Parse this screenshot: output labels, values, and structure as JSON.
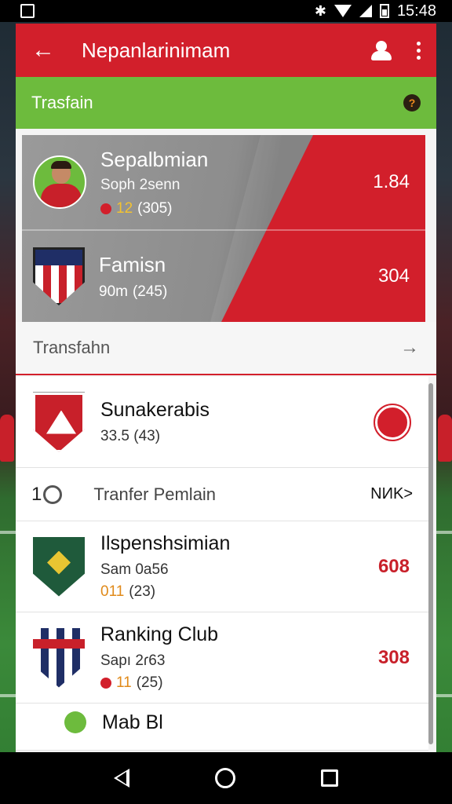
{
  "status_bar": {
    "time": "15:48",
    "icons": [
      "gallery-icon",
      "bluetooth-icon",
      "wifi-icon",
      "signal-icon",
      "battery-icon"
    ]
  },
  "header": {
    "title": "Nepanlarinimam",
    "back_icon": "arrow-left-icon",
    "action_icons": [
      "profile-icon",
      "more-vert-icon"
    ]
  },
  "subheader": {
    "label": "Trasfain",
    "icon": "info-icon"
  },
  "featured": {
    "rows": [
      {
        "name": "Sepalbmian",
        "sub": "Soph  2senn",
        "stat_num": "12",
        "stat_paren": "(305)",
        "value": "1.84"
      },
      {
        "name": "Famisn",
        "sub": "",
        "stat_num": "90m",
        "stat_paren": "(245)",
        "value": "304"
      }
    ]
  },
  "transfers_header": {
    "label": "Transfahn",
    "arrow": "→"
  },
  "list": {
    "items": [
      {
        "name": "Sunakerabis",
        "sub": "",
        "stat": "33.5  (43)",
        "value": ""
      },
      {
        "name": "Ilspenshsimian",
        "sub": "Sam  0a56",
        "stat_num": "011",
        "stat_paren": "(23)",
        "value": "608"
      },
      {
        "name": "Ranking Club",
        "sub": "Sapı  2ɾ63",
        "stat_num": "11",
        "stat_paren": "(25)",
        "value": "308"
      },
      {
        "name": "Mab Bl",
        "sub": "",
        "value": ""
      }
    ],
    "promo": {
      "number": "1",
      "text": "Tranfer Pemlain",
      "tag": "NИK>"
    }
  },
  "colors": {
    "primary_red": "#d21f2b",
    "accent_green": "#6dbb3d",
    "value_red": "#c8202a"
  }
}
